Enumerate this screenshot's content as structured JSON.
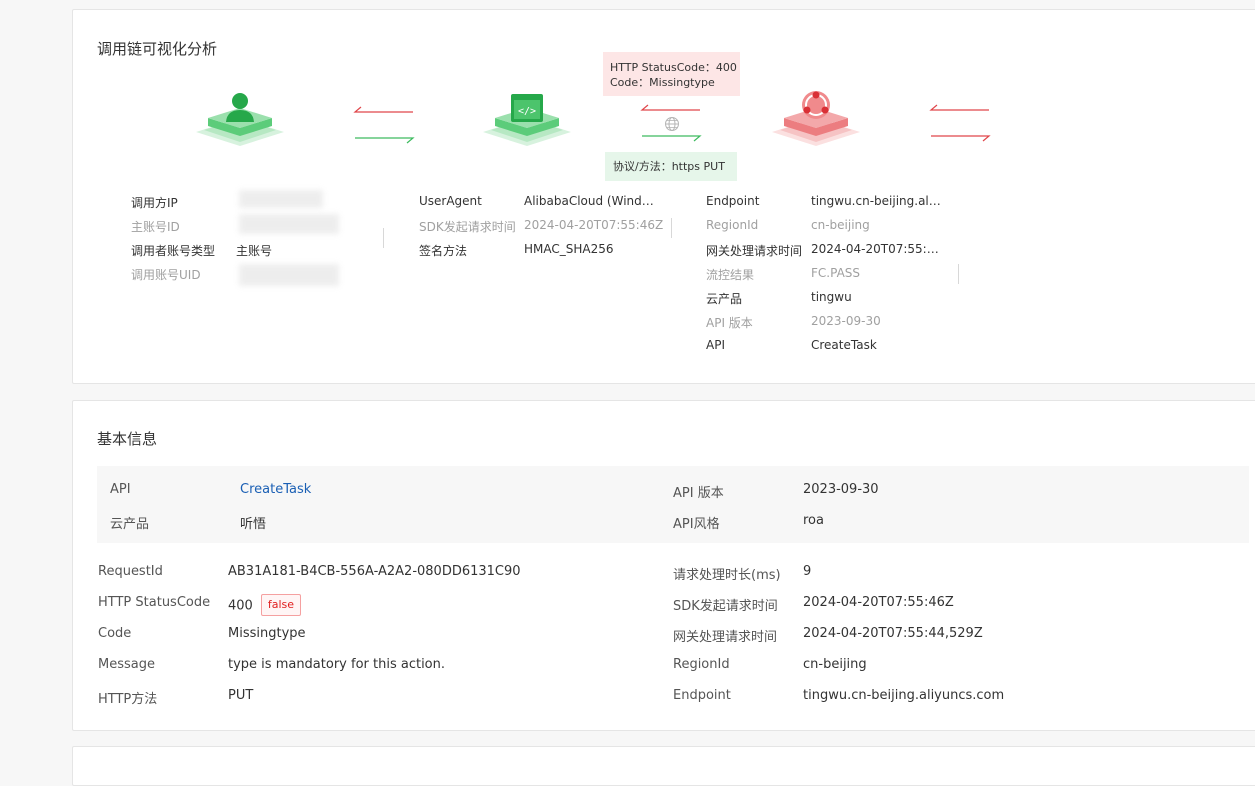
{
  "chain": {
    "title": "调用链可视化分析",
    "error_tip": {
      "status_line": "HTTP StatusCode：400",
      "code_line": "Code：Missingtype"
    },
    "protocol_tip": "协议/方法：https PUT",
    "caller": [
      {
        "key": "调用方IP",
        "value": ""
      },
      {
        "key": "主账号ID",
        "value": ""
      },
      {
        "key": "调用者账号类型",
        "value": "主账号"
      },
      {
        "key": "调用账号UID",
        "value": ""
      }
    ],
    "sdk": [
      {
        "key": "UserAgent",
        "value": "AlibabaCloud (Windo..."
      },
      {
        "key": "SDK发起请求时间",
        "value": "2024-04-20T07:55:46Z"
      },
      {
        "key": "签名方法",
        "value": "HMAC_SHA256"
      }
    ],
    "gateway": [
      {
        "key": "Endpoint",
        "value": "tingwu.cn-beijing.aliy..."
      },
      {
        "key": "RegionId",
        "value": "cn-beijing"
      },
      {
        "key": "网关处理请求时间",
        "value": "2024-04-20T07:55:44,..."
      },
      {
        "key": "流控结果",
        "value": "FC.PASS"
      },
      {
        "key": "云产品",
        "value": "tingwu"
      },
      {
        "key": "API 版本",
        "value": "2023-09-30"
      },
      {
        "key": "API",
        "value": "CreateTask"
      }
    ],
    "colors": {
      "success": "#3dbb5f",
      "error": "#e0464a"
    }
  },
  "basic": {
    "title": "基本信息",
    "band_left": [
      {
        "key": "API",
        "value": "CreateTask"
      },
      {
        "key": "云产品",
        "value": "听悟"
      }
    ],
    "band_right": [
      {
        "key": "API 版本",
        "value": "2023-09-30"
      },
      {
        "key": "API风格",
        "value": "roa"
      }
    ],
    "left": [
      {
        "key": "RequestId",
        "value": "AB31A181-B4CB-556A-A2A2-080DD6131C90"
      },
      {
        "key": "HTTP StatusCode",
        "value": "400",
        "badge": "false"
      },
      {
        "key": "Code",
        "value": "Missingtype"
      },
      {
        "key": "Message",
        "value": "type is mandatory for this action."
      },
      {
        "key": "HTTP方法",
        "value": "PUT"
      }
    ],
    "right": [
      {
        "key": "请求处理时长(ms)",
        "value": "9"
      },
      {
        "key": "SDK发起请求时间",
        "value": "2024-04-20T07:55:46Z"
      },
      {
        "key": "网关处理请求时间",
        "value": "2024-04-20T07:55:44,529Z"
      },
      {
        "key": "RegionId",
        "value": "cn-beijing"
      },
      {
        "key": "Endpoint",
        "value": "tingwu.cn-beijing.aliyuncs.com"
      }
    ]
  }
}
